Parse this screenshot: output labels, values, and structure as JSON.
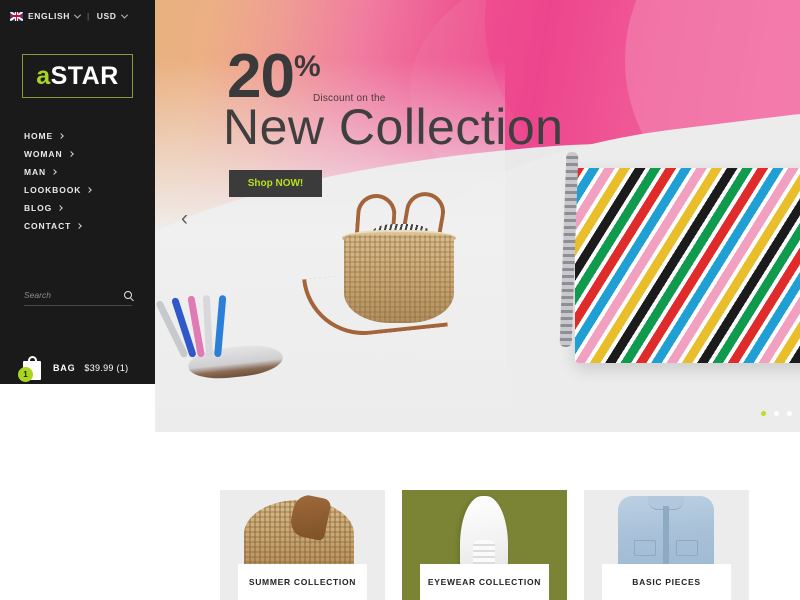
{
  "topbar": {
    "flag_icon": "uk-flag-icon",
    "language": "ENGLISH",
    "separator": "|",
    "currency": "USD",
    "caret_icon": "chevron-down-icon"
  },
  "logo": {
    "prefix": "a",
    "suffix": "STAR",
    "accent_color": "#a9d51e"
  },
  "nav": {
    "items": [
      {
        "label": "HOME"
      },
      {
        "label": "WOMAN"
      },
      {
        "label": "MAN"
      },
      {
        "label": "LOOKBOOK"
      },
      {
        "label": "BLOG"
      },
      {
        "label": "CONTACT"
      }
    ],
    "chevron_icon": "chevron-right-icon"
  },
  "search": {
    "placeholder": "Search",
    "value": "",
    "icon": "search-icon"
  },
  "bag": {
    "icon": "shopping-bag-icon",
    "badge_count": "1",
    "label": "BAG",
    "price": "$39.99 (1)"
  },
  "hero": {
    "percent_number": "20",
    "percent_symbol": "%",
    "subtitle": "Discount on the",
    "headline": "New Collection",
    "cta_label": "Shop NOW!",
    "cta_text_color": "#b7e01f",
    "prev_icon": "chevron-left-icon",
    "dots": [
      {
        "active": true
      },
      {
        "active": false
      },
      {
        "active": false
      }
    ],
    "products": [
      "metallic-sandal",
      "wicker-basket-bag",
      "striped-chain-bag"
    ]
  },
  "categories": [
    {
      "label": "SUMMER COLLECTION",
      "bg": "#ececec",
      "product": "wicker-bag"
    },
    {
      "label": "EYEWEAR COLLECTION",
      "bg": "#7a8434",
      "product": "white-sneaker"
    },
    {
      "label": "BASIC PIECES",
      "bg": "#ececec",
      "product": "denim-jacket"
    }
  ]
}
